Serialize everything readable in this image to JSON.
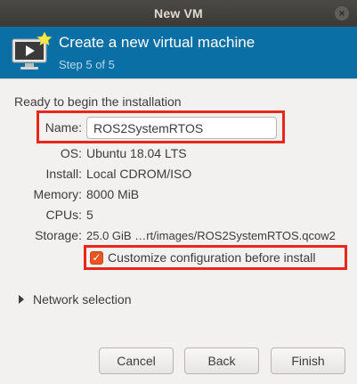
{
  "window": {
    "title": "New VM",
    "close_glyph": "×"
  },
  "banner": {
    "title": "Create a new virtual machine",
    "step": "Step 5 of 5",
    "icon": "monitor-with-star-icon"
  },
  "intro": "Ready to begin the installation",
  "fields": {
    "name_label": "Name:",
    "name_value": "ROS2SystemRTOS",
    "os_label": "OS:",
    "os_value": "Ubuntu 18.04 LTS",
    "install_label": "Install:",
    "install_value": "Local CDROM/ISO",
    "memory_label": "Memory:",
    "memory_value": "8000 MiB",
    "cpus_label": "CPUs:",
    "cpus_value": "5",
    "storage_label": "Storage:",
    "storage_value": "25.0 GiB …rt/images/ROS2SystemRTOS.qcow2"
  },
  "customize": {
    "label": "Customize configuration before install",
    "checked": true,
    "check_glyph": "✓"
  },
  "network": {
    "label": "Network selection",
    "expanded": false
  },
  "buttons": {
    "cancel": "Cancel",
    "back": "Back",
    "finish": "Finish"
  },
  "colors": {
    "banner": "#0a6fa4",
    "highlight": "#e8271a",
    "checkbox": "#e95420"
  }
}
